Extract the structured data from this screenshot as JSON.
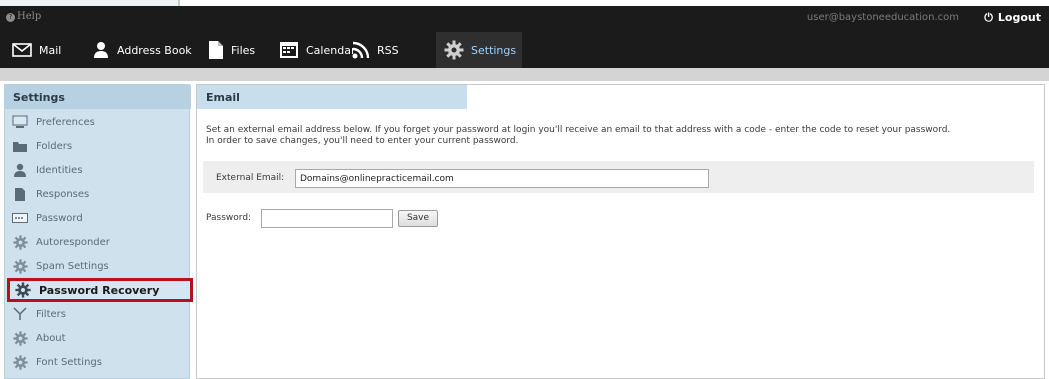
{
  "header": {
    "help_label": "Help",
    "user_email": "user@baystoneeducation.com",
    "logout_label": "Logout"
  },
  "nav": {
    "items": [
      {
        "label": "Mail",
        "icon": "envelope-icon"
      },
      {
        "label": "Address Book",
        "icon": "person-icon"
      },
      {
        "label": "Files",
        "icon": "file-icon"
      },
      {
        "label": "Calendar",
        "icon": "calendar-icon"
      },
      {
        "label": "RSS",
        "icon": "rss-icon"
      },
      {
        "label": "Settings",
        "icon": "gear-icon",
        "active": true
      }
    ]
  },
  "sidebar": {
    "title": "Settings",
    "items": [
      {
        "label": "Preferences",
        "icon": "monitor-icon"
      },
      {
        "label": "Folders",
        "icon": "folder-icon"
      },
      {
        "label": "Identities",
        "icon": "person-icon"
      },
      {
        "label": "Responses",
        "icon": "document-icon"
      },
      {
        "label": "Password",
        "icon": "password-field-icon"
      },
      {
        "label": "Autoresponder",
        "icon": "gear-icon"
      },
      {
        "label": "Spam Settings",
        "icon": "gear-icon"
      },
      {
        "label": "Password Recovery",
        "icon": "gear-icon",
        "active": true
      },
      {
        "label": "Filters",
        "icon": "filter-icon"
      },
      {
        "label": "About",
        "icon": "gear-icon"
      },
      {
        "label": "Font Settings",
        "icon": "gear-icon"
      }
    ]
  },
  "main": {
    "title": "Email",
    "description_line1": "Set an external email address below. If you forget your password at login you'll receive an email to that address with a code - enter the code to reset your password.",
    "description_line2": "In order to save changes, you'll need to enter your current password.",
    "external_email_label": "External Email:",
    "external_email_value": "Domains@onlinepracticemail.com",
    "password_label": "Password:",
    "password_value": "",
    "save_label": "Save"
  },
  "colors": {
    "header_bg": "#1b1b1b",
    "active_nav": "#9fd3ff",
    "sidebar_bg": "#cfe1ed",
    "highlight_border": "#b5121b"
  }
}
